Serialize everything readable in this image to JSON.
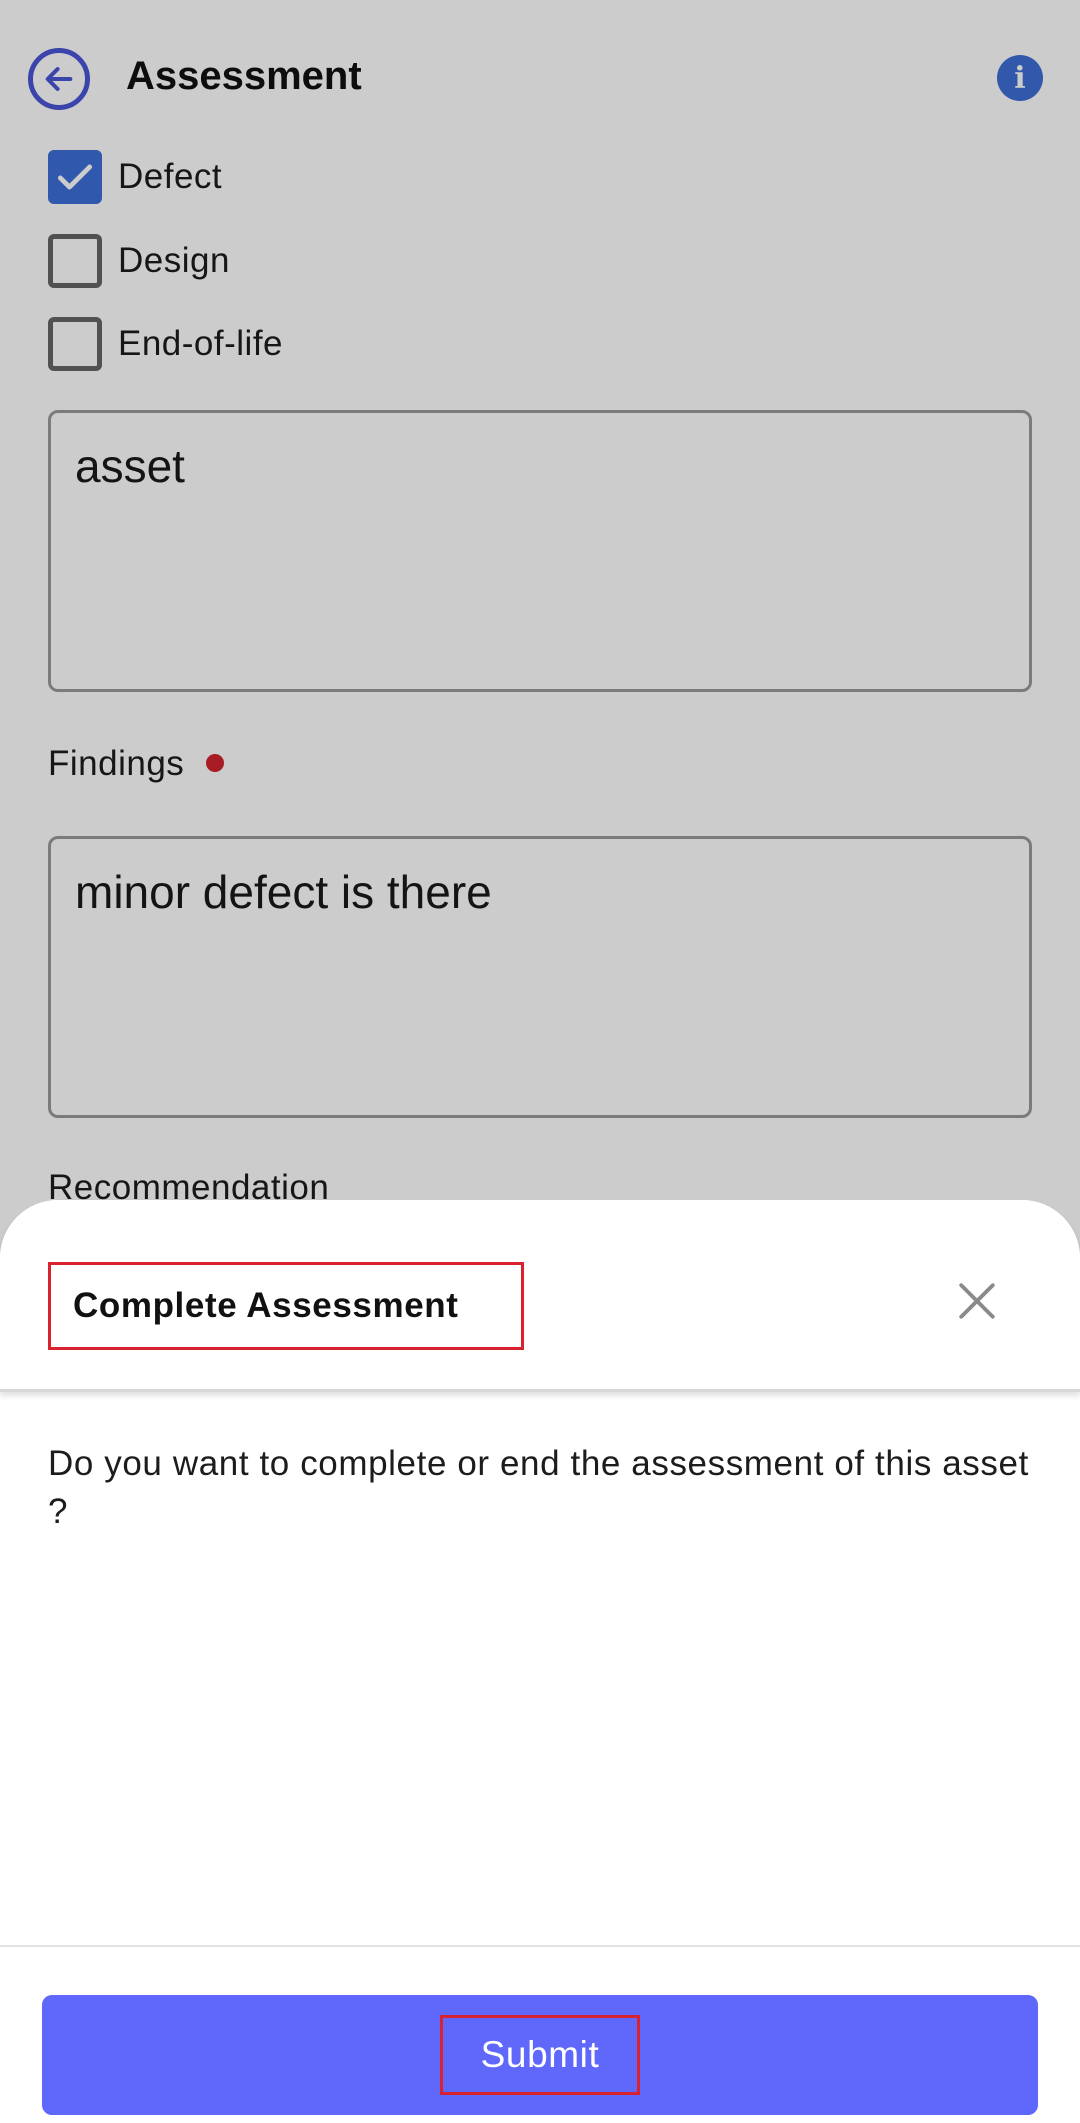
{
  "header": {
    "title": "Assessment",
    "back_icon": "arrow-left-circle-icon",
    "info_icon": "info-icon",
    "info_glyph": "i"
  },
  "checkboxes": [
    {
      "label": "Defect",
      "checked": true
    },
    {
      "label": "Design",
      "checked": false
    },
    {
      "label": "End-of-life",
      "checked": false
    }
  ],
  "fields": {
    "first_textarea_value": "asset",
    "findings_label": "Findings",
    "findings_value": "minor defect is there",
    "recommendation_label": "Recommendation"
  },
  "sheet": {
    "title": "Complete Assessment",
    "message": "Do you want to complete or end the assessment of this asset ?",
    "submit_label": "Submit",
    "close_icon": "close-icon"
  },
  "colors": {
    "accent": "#4a56d6",
    "checkbox_checked": "#3d6fd9",
    "required": "#d1242f",
    "submit": "#5f68fb",
    "highlight": "#d9222f"
  }
}
